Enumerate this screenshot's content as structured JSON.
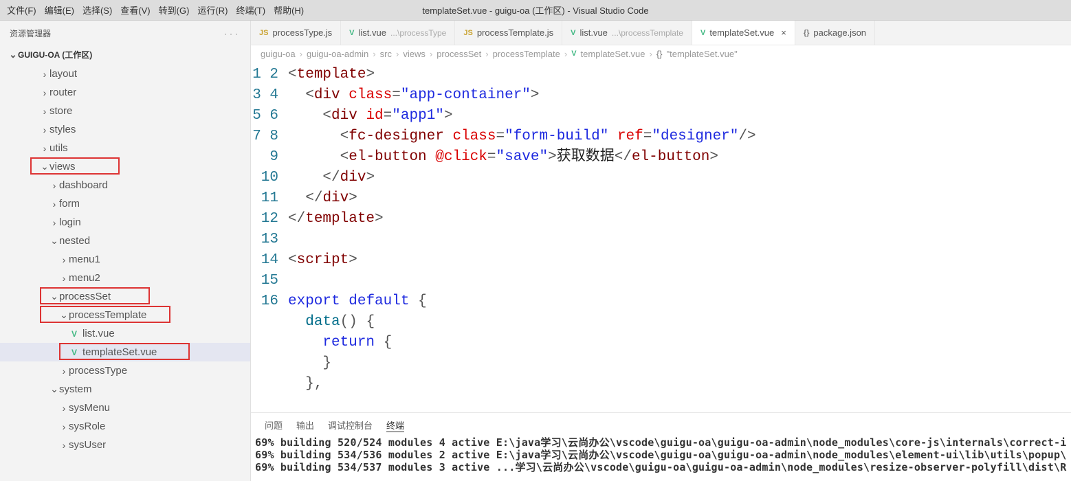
{
  "window": {
    "title": "templateSet.vue - guigu-oa (工作区) - Visual Studio Code"
  },
  "menu": [
    "文件(F)",
    "编辑(E)",
    "选择(S)",
    "查看(V)",
    "转到(G)",
    "运行(R)",
    "终端(T)",
    "帮助(H)"
  ],
  "sidebar": {
    "title": "资源管理器",
    "project": "GUIGU-OA (工作区)",
    "tree": [
      {
        "indent": 58,
        "chev": "›",
        "label": "layout"
      },
      {
        "indent": 58,
        "chev": "›",
        "label": "router"
      },
      {
        "indent": 58,
        "chev": "›",
        "label": "store"
      },
      {
        "indent": 58,
        "chev": "›",
        "label": "styles"
      },
      {
        "indent": 58,
        "chev": "›",
        "label": "utils"
      },
      {
        "indent": 58,
        "chev": "⌄",
        "label": "views",
        "box": true
      },
      {
        "indent": 72,
        "chev": "›",
        "label": "dashboard"
      },
      {
        "indent": 72,
        "chev": "›",
        "label": "form"
      },
      {
        "indent": 72,
        "chev": "›",
        "label": "login"
      },
      {
        "indent": 72,
        "chev": "⌄",
        "label": "nested"
      },
      {
        "indent": 86,
        "chev": "›",
        "label": "menu1"
      },
      {
        "indent": 86,
        "chev": "›",
        "label": "menu2"
      },
      {
        "indent": 72,
        "chev": "⌄",
        "label": "processSet",
        "box": true
      },
      {
        "indent": 72,
        "chev": "⌄",
        "label": "processTemplate",
        "box": true,
        "extraIndent": 14
      },
      {
        "indent": 100,
        "icon": "vue",
        "label": "list.vue"
      },
      {
        "indent": 100,
        "icon": "vue",
        "label": "templateSet.vue",
        "selected": true,
        "box": true
      },
      {
        "indent": 86,
        "chev": "›",
        "label": "processType"
      },
      {
        "indent": 72,
        "chev": "⌄",
        "label": "system"
      },
      {
        "indent": 86,
        "chev": "›",
        "label": "sysMenu"
      },
      {
        "indent": 86,
        "chev": "›",
        "label": "sysRole"
      },
      {
        "indent": 86,
        "chev": "›",
        "label": "sysUser"
      }
    ]
  },
  "tabs": [
    {
      "icon": "js",
      "label": "processType.js"
    },
    {
      "icon": "vue",
      "label": "list.vue",
      "path": "...\\processType"
    },
    {
      "icon": "js",
      "label": "processTemplate.js"
    },
    {
      "icon": "vue",
      "label": "list.vue",
      "path": "...\\processTemplate"
    },
    {
      "icon": "vue",
      "label": "templateSet.vue",
      "active": true,
      "close": true
    },
    {
      "icon": "json",
      "label": "package.json"
    }
  ],
  "breadcrumb": [
    "guigu-oa",
    "guigu-oa-admin",
    "src",
    "views",
    "processSet",
    "processTemplate",
    "templateSet.vue",
    "\"templateSet.vue\""
  ],
  "code_lines": [
    1,
    2,
    3,
    4,
    5,
    6,
    7,
    8,
    9,
    10,
    11,
    12,
    13,
    14,
    15,
    16
  ],
  "code": {
    "l5_text": "获取数据"
  },
  "panel": {
    "tabs": [
      "问题",
      "输出",
      "调试控制台",
      "终端"
    ],
    "term_lines": [
      "69% building 520/524 modules 4 active E:\\java学习\\云尚办公\\vscode\\guigu-oa\\guigu-oa-admin\\node_modules\\core-js\\internals\\correct-i",
      "69% building 534/536 modules 2 active E:\\java学习\\云尚办公\\vscode\\guigu-oa\\guigu-oa-admin\\node_modules\\element-ui\\lib\\utils\\popup\\",
      "69% building 534/537 modules 3 active  ...学习\\云尚办公\\vscode\\guigu-oa\\guigu-oa-admin\\node_modules\\resize-observer-polyfill\\dist\\R"
    ]
  }
}
